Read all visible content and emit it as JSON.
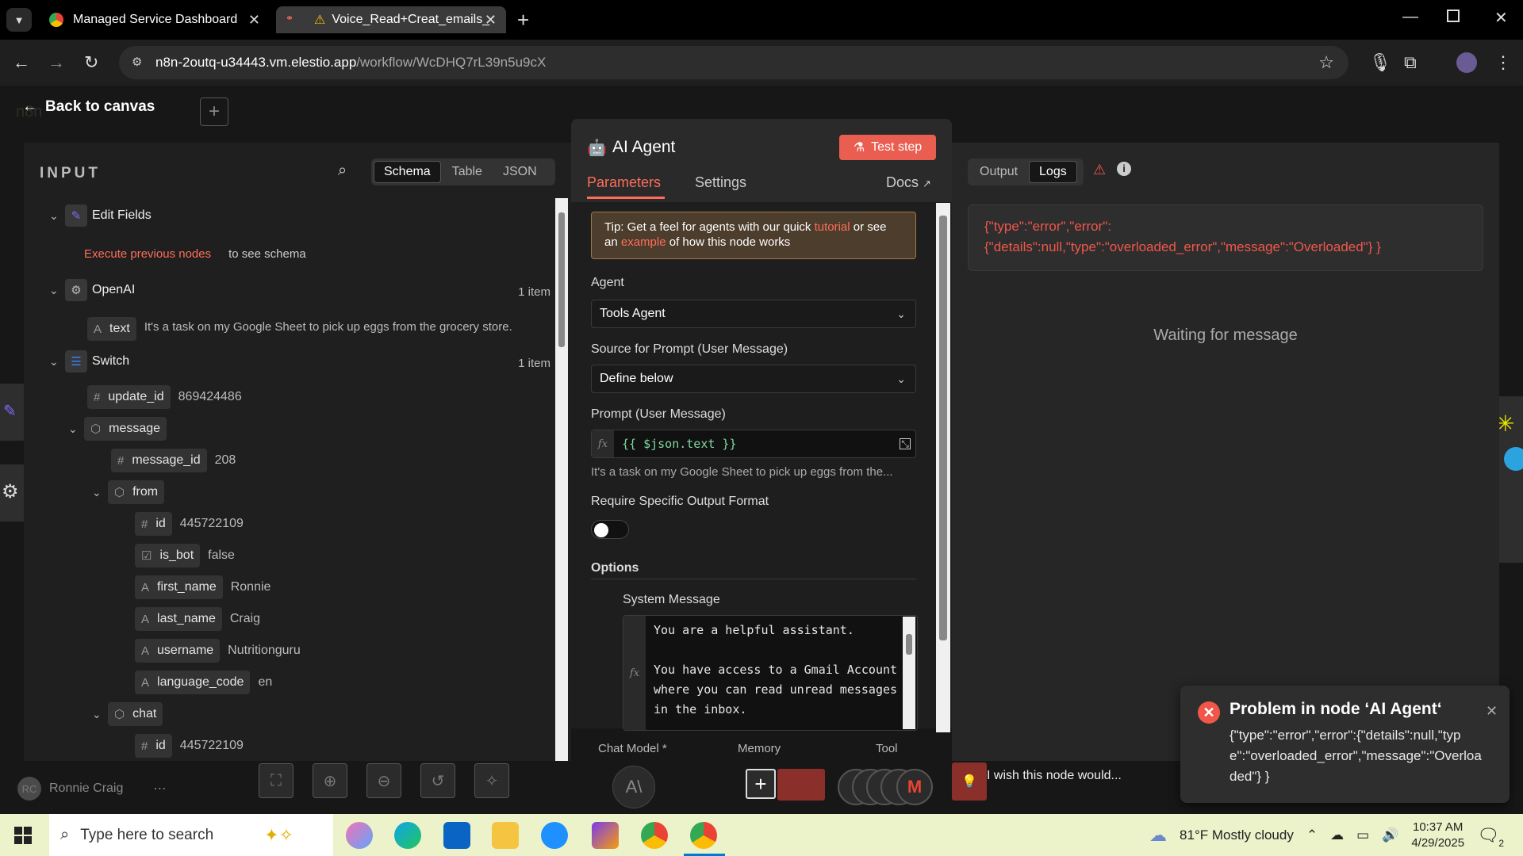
{
  "browser": {
    "tabs": [
      {
        "title": "Managed Service Dashboard",
        "active": false
      },
      {
        "title": "Voice_Read+Creat_emails_s",
        "active": true
      }
    ],
    "url_host": "n8n-2outq-u34443.vm.elestio.app",
    "url_path": "/workflow/WcDHQ7rL39n5u9cX"
  },
  "header": {
    "back_label": "Back to canvas",
    "logo_text": "n8n"
  },
  "input_panel": {
    "title": "INPUT",
    "view_options": [
      "Schema",
      "Table",
      "JSON"
    ],
    "active_view": "Schema",
    "edit_fields": {
      "name": "Edit Fields",
      "hint_link": "Execute previous nodes",
      "hint_text": "to see schema"
    },
    "openai": {
      "name": "OpenAI",
      "count": "1 item",
      "field": "text",
      "field_type": "A",
      "value": "It's a task on my Google Sheet to pick up eggs from the grocery store."
    },
    "switch": {
      "name": "Switch",
      "count": "1 item"
    },
    "fields": [
      {
        "type": "#",
        "name": "update_id",
        "value": "869424486"
      },
      {
        "type": "obj",
        "name": "message",
        "value": ""
      },
      {
        "type": "#",
        "name": "message_id",
        "value": "208"
      },
      {
        "type": "obj",
        "name": "from",
        "value": ""
      },
      {
        "type": "#",
        "name": "id",
        "value": "445722109"
      },
      {
        "type": "bool",
        "name": "is_bot",
        "value": "false"
      },
      {
        "type": "A",
        "name": "first_name",
        "value": "Ronnie"
      },
      {
        "type": "A",
        "name": "last_name",
        "value": "Craig"
      },
      {
        "type": "A",
        "name": "username",
        "value": "Nutritionguru"
      },
      {
        "type": "A",
        "name": "language_code",
        "value": "en"
      },
      {
        "type": "obj",
        "name": "chat",
        "value": ""
      },
      {
        "type": "#",
        "name": "id",
        "value": "445722109"
      }
    ]
  },
  "agent": {
    "title": "AI Agent",
    "test_step": "Test step",
    "tabs": {
      "params": "Parameters",
      "settings": "Settings",
      "docs": "Docs"
    },
    "tip": {
      "a": "Tip: Get a feel for agents with our quick ",
      "link1": "tutorial",
      "b": " or see an ",
      "link2": "example",
      "c": " of how this node works"
    },
    "agent_label": "Agent",
    "agent_value": "Tools Agent",
    "source_label": "Source for Prompt (User Message)",
    "source_value": "Define below",
    "prompt_label": "Prompt (User Message)",
    "prompt_value": "{{ $json.text }}",
    "prompt_preview": "It's a task on my Google Sheet to pick up eggs from the...",
    "require_label": "Require Specific Output Format",
    "require_on": false,
    "options_label": "Options",
    "system_label": "System Message",
    "system_value": "You are a helpful assistant.\n\nYou have access to a Gmail Account where you can read unread messages in the inbox.",
    "sub_nodes": [
      "Chat Model *",
      "Memory",
      "Tool"
    ],
    "fx": "fx"
  },
  "output_panel": {
    "tabs": [
      "Output",
      "Logs"
    ],
    "active": "Logs",
    "error_text": "{\"type\":\"error\",\"error\":{\"details\":null,\"type\":\"overloaded_error\",\"message\":\"Overloaded\"} }",
    "waiting": "Waiting for message"
  },
  "canvas": {
    "user_initials": "RC",
    "user_name": "Ronnie Craig",
    "feedback_text": "I wish this node would..."
  },
  "toast": {
    "title": "Problem in node ‘AI Agent‘",
    "body": "{\"type\":\"error\",\"error\":{\"details\":null,\"type\":\"overloaded_error\",\"message\":\"Overloaded\"} }"
  },
  "taskbar": {
    "search_placeholder": "Type here to search",
    "weather": "81°F  Mostly cloudy",
    "time": "10:37 AM",
    "date": "4/29/2025",
    "notif_count": "2"
  },
  "colors": {
    "accent": "#ff6d5a",
    "error": "#f0574a",
    "tip_bg": "#4c3d2c"
  }
}
